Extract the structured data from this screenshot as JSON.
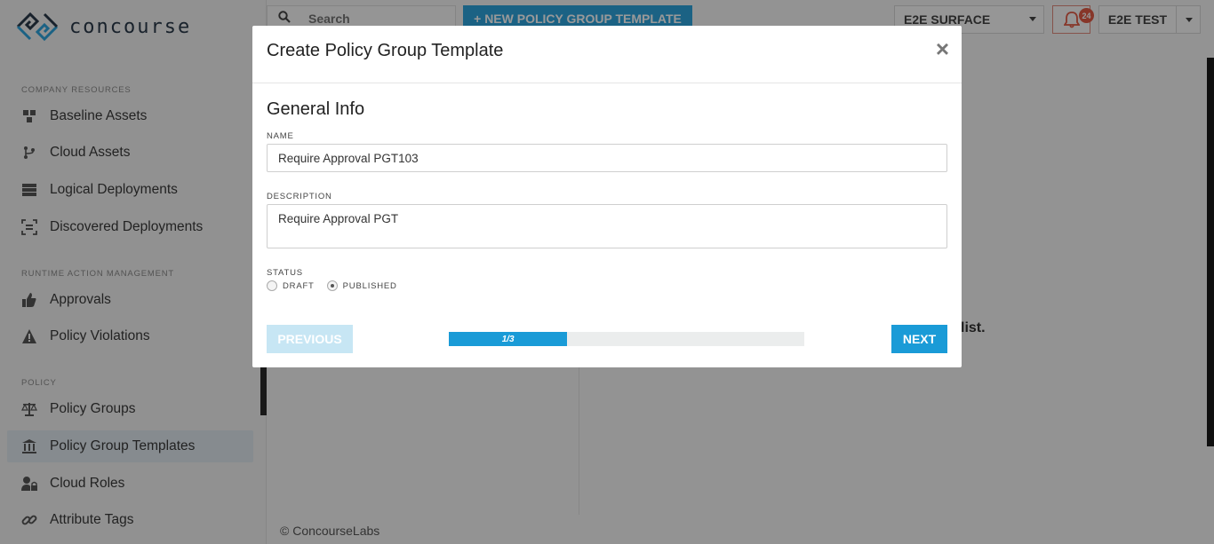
{
  "app": {
    "logo_text": "concourse",
    "brand_color": "#2ea3dc"
  },
  "sidebar": {
    "sections": [
      {
        "label": "COMPANY RESOURCES"
      },
      {
        "label": "RUNTIME ACTION MANAGEMENT"
      },
      {
        "label": "POLICY"
      }
    ],
    "items": [
      {
        "label": "Baseline Assets",
        "icon": "cubes-icon"
      },
      {
        "label": "Cloud Assets",
        "icon": "branch-icon"
      },
      {
        "label": "Logical Deployments",
        "icon": "server-icon"
      },
      {
        "label": "Discovered Deployments",
        "icon": "scan-icon"
      },
      {
        "label": "Approvals",
        "icon": "thumbs-up-icon"
      },
      {
        "label": "Policy Violations",
        "icon": "warning-icon"
      },
      {
        "label": "Policy Groups",
        "icon": "balance-scale-icon"
      },
      {
        "label": "Policy Group Templates",
        "icon": "institution-icon",
        "active": true
      },
      {
        "label": "Cloud Roles",
        "icon": "user-lock-icon"
      },
      {
        "label": "Attribute Tags",
        "icon": "link-icon"
      }
    ]
  },
  "header": {
    "search_placeholder": "Search",
    "new_button_label": "+ NEW POLICY GROUP TEMPLATE",
    "org_select_value": "E2E SURFACE",
    "notification_count": "24",
    "user_label": "E2E TEST"
  },
  "background": {
    "list_text": "list.",
    "footer": "© ConcourseLabs"
  },
  "modal": {
    "title": "Create Policy Group Template",
    "close_label": "×",
    "section_title": "General Info",
    "name_label": "NAME",
    "name_value": "Require Approval PGT103",
    "description_label": "DESCRIPTION",
    "description_value": "Require Approval PGT",
    "status_label": "STATUS",
    "status_options": [
      {
        "label": "DRAFT",
        "checked": false
      },
      {
        "label": "PUBLISHED",
        "checked": true
      }
    ],
    "previous_label": "PREVIOUS",
    "next_label": "NEXT",
    "progress": {
      "step": 1,
      "total": 3,
      "text": "1/3"
    }
  }
}
